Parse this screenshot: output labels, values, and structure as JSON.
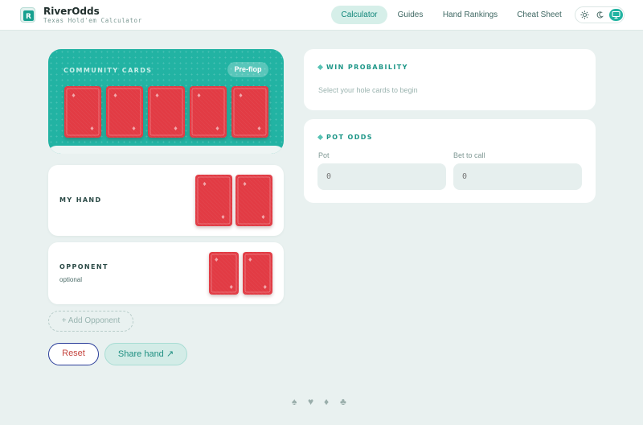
{
  "app": {
    "name": "RiverOdds",
    "subtitle": "Texas Hold'em Calculator",
    "logo_letter": "R"
  },
  "nav": {
    "items": [
      {
        "label": "Calculator",
        "active": true
      },
      {
        "label": "Guides",
        "active": false
      },
      {
        "label": "Hand Rankings",
        "active": false
      },
      {
        "label": "Cheat Sheet",
        "active": false
      }
    ],
    "theme_options": [
      {
        "icon": "sun-icon",
        "active": false
      },
      {
        "icon": "moon-icon",
        "active": false
      },
      {
        "icon": "monitor-icon",
        "active": true
      }
    ]
  },
  "community": {
    "label": "COMMUNITY CARDS",
    "stage": "Pre-flop",
    "card_count": 5
  },
  "my_hand": {
    "label": "MY HAND",
    "card_count": 2
  },
  "opponent": {
    "label": "OPPONENT",
    "note": "optional",
    "card_count": 2
  },
  "actions": {
    "add_opponent": "+ Add Opponent",
    "reset": "Reset",
    "share": "Share hand ↗"
  },
  "win_probability": {
    "label": "WIN PROBABILITY",
    "message": "Select your hole cards to begin"
  },
  "pot_odds": {
    "label": "POT ODDS",
    "pot_label": "Pot",
    "pot_placeholder": "0",
    "bet_label": "Bet to call",
    "bet_placeholder": "0"
  },
  "footer": {
    "suits": [
      "♠",
      "♥",
      "♦",
      "♣"
    ]
  },
  "colors": {
    "accent": "#22b3a3",
    "card_back": "#e23b44",
    "background": "#e9f1f0",
    "reset_text": "#c5443d"
  }
}
